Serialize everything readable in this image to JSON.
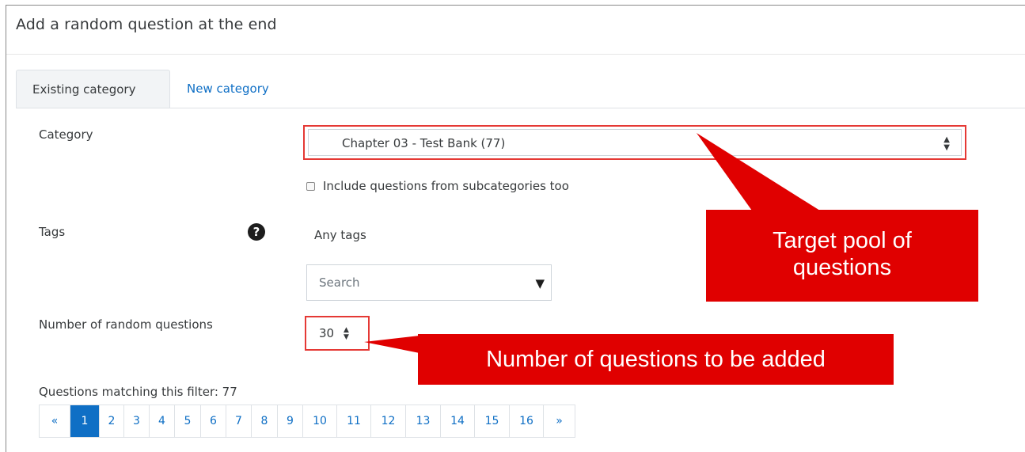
{
  "modal": {
    "title": "Add a random question at the end"
  },
  "tabs": [
    {
      "label": "Existing category",
      "active": true
    },
    {
      "label": "New category",
      "active": false
    }
  ],
  "form": {
    "category_label": "Category",
    "category_value": "Chapter 03 - Test Bank (77)",
    "include_subcategories_label": "Include questions from subcategories too",
    "include_subcategories_checked": false,
    "tags_label": "Tags",
    "tags_value": "Any tags",
    "tags_search_placeholder": "Search",
    "number_label": "Number of random questions",
    "number_value": "30",
    "matching_text": "Questions matching this filter: 77"
  },
  "pagination": {
    "prev": "«",
    "next": "»",
    "current": "1",
    "pages": [
      "1",
      "2",
      "3",
      "4",
      "5",
      "6",
      "7",
      "8",
      "9",
      "10",
      "11",
      "12",
      "13",
      "14",
      "15",
      "16"
    ]
  },
  "annotations": {
    "pool_callout_line1": "Target pool of",
    "pool_callout_line2": "questions",
    "number_callout": "Number of questions to be added"
  },
  "colors": {
    "link": "#0f6fc5",
    "annotation_red": "#e00000",
    "highlight_border": "#e53935"
  }
}
